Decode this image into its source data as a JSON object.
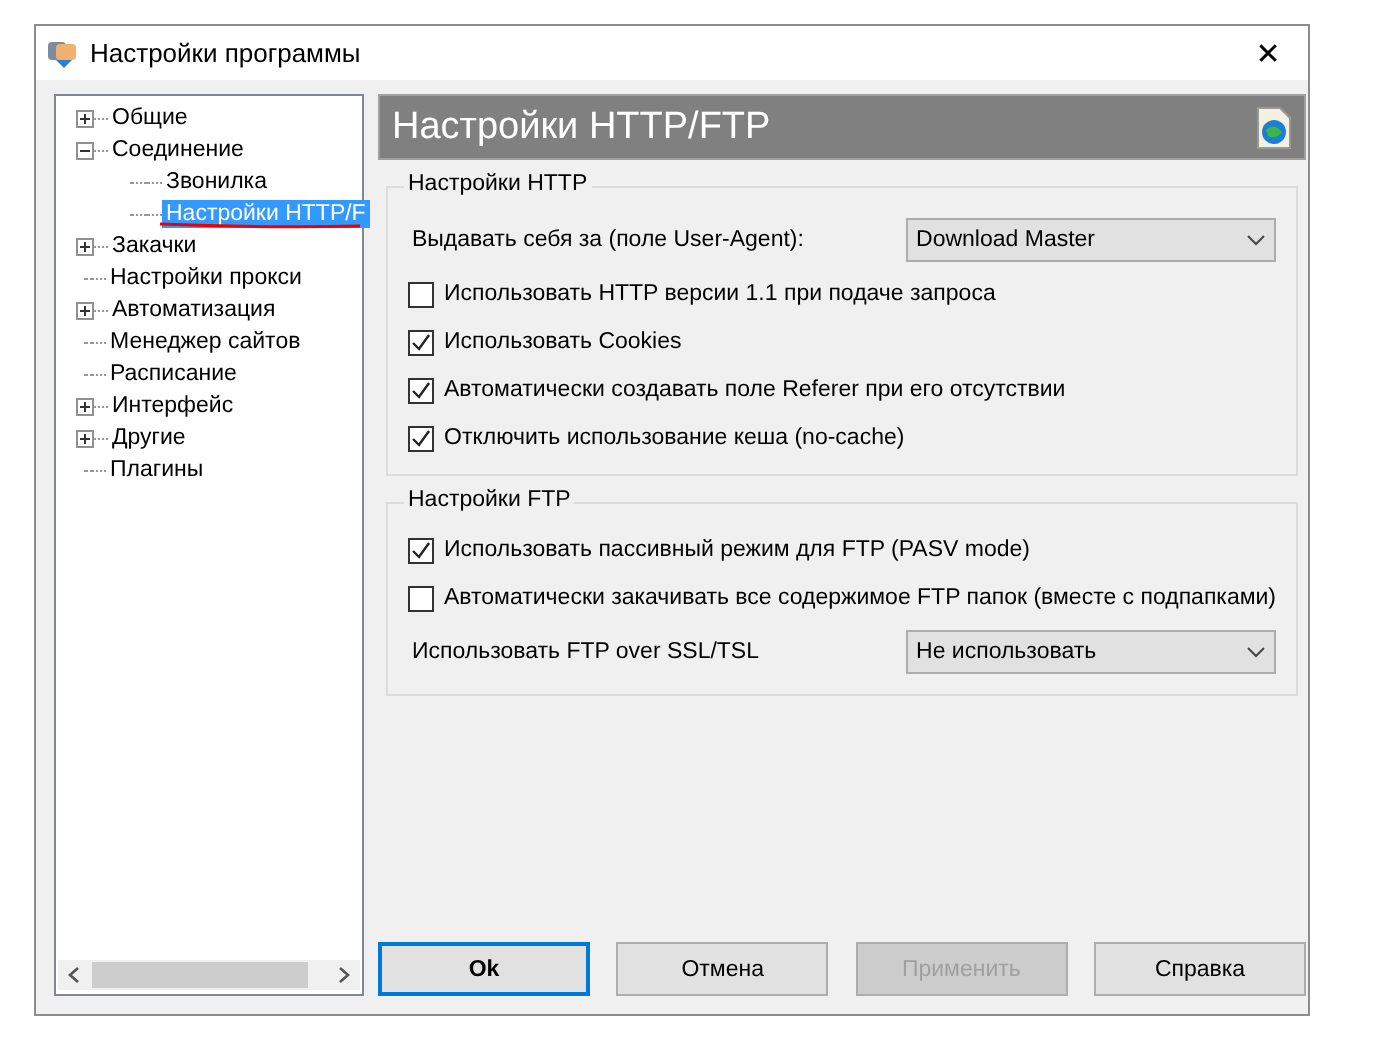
{
  "window": {
    "title": "Настройки программы",
    "close": "✕"
  },
  "tree": [
    {
      "label": "Общие",
      "expanded": false,
      "selected": false
    },
    {
      "label": "Соединение",
      "expanded": true,
      "selected": false,
      "children": [
        {
          "label": "Звонилка",
          "selected": false
        },
        {
          "label": "Настройки HTTP/F",
          "selected": true
        }
      ]
    },
    {
      "label": "Закачки",
      "expanded": false,
      "selected": false
    },
    {
      "label": "Настройки прокси",
      "selected": false
    },
    {
      "label": "Автоматизация",
      "expanded": false,
      "selected": false
    },
    {
      "label": "Менеджер сайтов",
      "selected": false
    },
    {
      "label": "Расписание",
      "selected": false
    },
    {
      "label": "Интерфейс",
      "expanded": false,
      "selected": false
    },
    {
      "label": "Другие",
      "expanded": false,
      "selected": false
    },
    {
      "label": "Плагины",
      "selected": false
    }
  ],
  "header": {
    "title": "Настройки HTTP/FTP"
  },
  "groups": [
    {
      "title": "Настройки HTTP",
      "rows": [
        {
          "kind": "select",
          "label": "Выдавать себя за (поле User-Agent):",
          "value": "Download Master"
        },
        {
          "kind": "checkbox",
          "label": "Использовать HTTP версии 1.1 при подаче запроса",
          "checked": false
        },
        {
          "kind": "checkbox",
          "label": "Использовать Cookies",
          "checked": true
        },
        {
          "kind": "checkbox",
          "label": "Автоматически создавать поле Referer при его отсутствии",
          "checked": true
        },
        {
          "kind": "checkbox",
          "label": "Отключить использование кеша (no-cache)",
          "checked": true
        }
      ]
    },
    {
      "title": "Настройки FTP",
      "rows": [
        {
          "kind": "checkbox",
          "label": "Использовать пассивный режим для FTP (PASV mode)",
          "checked": true
        },
        {
          "kind": "checkbox",
          "label": "Автоматически закачивать все содержимое FTP папок (вместе с подпапками)",
          "checked": false
        },
        {
          "kind": "select",
          "label": "Использовать FTP over SSL/TSL",
          "value": "Не использовать"
        }
      ]
    }
  ],
  "buttons": [
    {
      "label": "Ok",
      "default": true,
      "disabled": false
    },
    {
      "label": "Отмена",
      "default": false,
      "disabled": false
    },
    {
      "label": "Применить",
      "default": false,
      "disabled": true
    },
    {
      "label": "Справка",
      "default": false,
      "disabled": false
    }
  ]
}
